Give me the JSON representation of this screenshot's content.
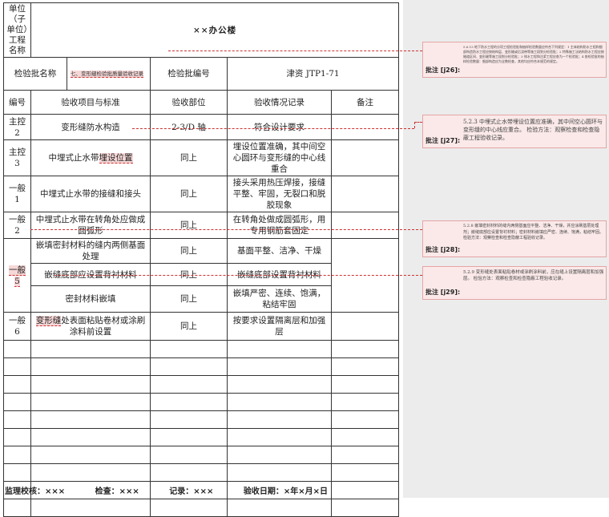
{
  "header": {
    "unit_label": "单位（子单位）工程名称",
    "project_name": "××办公楼",
    "batch_name_label": "检验批名称",
    "batch_name_value": "七、变形缝检验批质量验收记录",
    "batch_no_label": "检验批编号",
    "batch_no_value": "津资 JTP1-71"
  },
  "columns": [
    "编号",
    "验收项目与标准",
    "验收部位",
    "验收情况记录",
    "备注"
  ],
  "rows": [
    {
      "no": "主控 2",
      "item": "变形缝防水构造",
      "part": "2-3/D 轴",
      "record": "符合设计要求"
    },
    {
      "no": "主控 3",
      "item_pre": "中埋式止水带",
      "item_hl": "埋设位置",
      "part": "同上",
      "record": "埋设位置准确，其中间空心圆环与变形缝的中心线重合"
    },
    {
      "no": "一般 1",
      "item": "中埋式止水带的接缝和接头",
      "part": "同上",
      "record": "接头采用热压焊接，接缝平整、牢固，无裂口和脱胶现象"
    },
    {
      "no": "一般 2",
      "item": "中埋式止水带在转角处应做成圆弧形",
      "part": "同上",
      "record": "在转角处做成圆弧形，用专用钢筋套固定"
    },
    {
      "no": "",
      "item": "嵌填密封材料的缝内两侧基面处理",
      "part": "同上",
      "record": "基面平整、洁净、干燥"
    },
    {
      "no": "一般 5",
      "item": "嵌缝底部应设置背衬材料",
      "part": "同上",
      "record": "嵌缝底部设置背衬材料"
    },
    {
      "no": "",
      "item": "密封材料嵌填",
      "part": "同上",
      "record": "嵌填严密、连续、饱满，粘结牢固"
    },
    {
      "no": "一般 6",
      "item_hl": "变形缝",
      "item_post": "处表面粘贴卷材或涂刷涂料前设置",
      "part": "同上",
      "record": "按要求设置隔离层和加强层"
    }
  ],
  "footer": {
    "supervisor": "监理校核：×××",
    "inspector": "检查：×××",
    "recorder": "记录：×××",
    "date": "验收日期：×年×月×日"
  },
  "comments": [
    {
      "label": "批注 [j26]:",
      "text": "5.6.13 地下防水工程的分项工程检验批和抽样检验数量应符合下列规定：1 主体结构防水工程和细部构造防水工程应按结构层、变形缝或后浇带等施工段划分检验批；2 特殊施工法结构防水工程应按隧道区间、变形缝等施工段划分检验批；3 排水工程和注浆工程应各为一个检验批；4 各检验批的抽样检验数量：细部构造应为全数检查，其他均应符合本规范的规定。"
    },
    {
      "label": "批注 [j27]:",
      "text": "5.2.3 中埋式止水带埋设位置应准确，其中间空心圆环与变形缝的中心线应重合。 检验方法：观察检查和检查隐蔽工程验收记录。"
    },
    {
      "label": "批注 [j28]:",
      "text": "5.2.8 嵌填密封材料的缝内两侧基面应平整、洁净、干燥，并应涂刷基层处理剂；嵌缝底部应设置背衬材料；密封材料嵌填应严密、连续、饱满，粘结牢固。 检验方法：观察检查和检查隐蔽工程验收记录。"
    },
    {
      "label": "批注 [j29]:",
      "text": "5.2.9 变形缝处表面粘贴卷材或涂刷涂料前，应在缝上设置隔离层和加强层。 检验方法：观察检查和检查隐蔽工程验收记录。"
    }
  ]
}
